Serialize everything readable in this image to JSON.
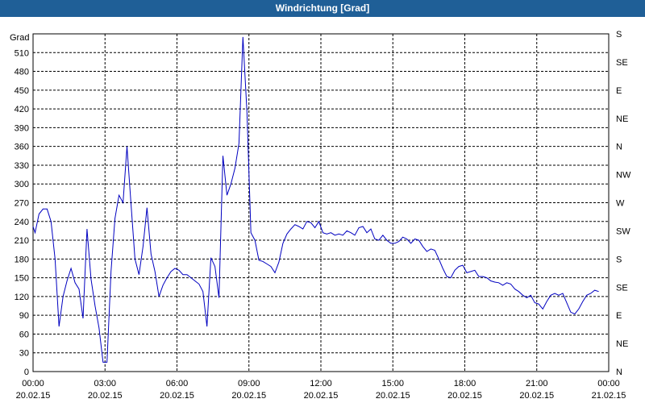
{
  "window": {
    "title": "Windrichtung [Grad]"
  },
  "chart_data": {
    "type": "line",
    "title": "Windrichtung [Grad]",
    "ylabel": "Grad",
    "xlabel": "",
    "grid": true,
    "legend": "none",
    "series_color": "#0000c0",
    "xlim_hours": [
      0,
      24
    ],
    "ylim": [
      0,
      540
    ],
    "y_ticks": [
      0,
      30,
      60,
      90,
      120,
      150,
      180,
      210,
      240,
      270,
      300,
      330,
      360,
      390,
      420,
      450,
      480,
      510
    ],
    "x_ticks": [
      {
        "time": "00:00",
        "date": "20.02.15"
      },
      {
        "time": "03:00",
        "date": "20.02.15"
      },
      {
        "time": "06:00",
        "date": "20.02.15"
      },
      {
        "time": "09:00",
        "date": "20.02.15"
      },
      {
        "time": "12:00",
        "date": "20.02.15"
      },
      {
        "time": "15:00",
        "date": "20.02.15"
      },
      {
        "time": "18:00",
        "date": "20.02.15"
      },
      {
        "time": "21:00",
        "date": "20.02.15"
      },
      {
        "time": "00:00",
        "date": "21.02.15"
      }
    ],
    "y2_ticks": [
      {
        "label": "N",
        "value": 0
      },
      {
        "label": "NE",
        "value": 45
      },
      {
        "label": "E",
        "value": 90
      },
      {
        "label": "SE",
        "value": 135
      },
      {
        "label": "S",
        "value": 180
      },
      {
        "label": "SW",
        "value": 225
      },
      {
        "label": "W",
        "value": 270
      },
      {
        "label": "NW",
        "value": 315
      },
      {
        "label": "N",
        "value": 360
      },
      {
        "label": "NE",
        "value": 405
      },
      {
        "label": "E",
        "value": 450
      },
      {
        "label": "SE",
        "value": 495
      },
      {
        "label": "S",
        "value": 540
      }
    ],
    "series": [
      {
        "values": [
          [
            "00:00",
            232
          ],
          [
            "00:05",
            222
          ],
          [
            "00:15",
            252
          ],
          [
            "00:25",
            260
          ],
          [
            "00:35",
            260
          ],
          [
            "00:45",
            240
          ],
          [
            "00:55",
            180
          ],
          [
            "01:05",
            72
          ],
          [
            "01:15",
            120
          ],
          [
            "01:25",
            145
          ],
          [
            "01:35",
            165
          ],
          [
            "01:45",
            142
          ],
          [
            "01:55",
            132
          ],
          [
            "02:05",
            85
          ],
          [
            "02:15",
            228
          ],
          [
            "02:25",
            148
          ],
          [
            "02:35",
            105
          ],
          [
            "02:45",
            70
          ],
          [
            "02:55",
            15
          ],
          [
            "03:05",
            15
          ],
          [
            "03:15",
            160
          ],
          [
            "03:25",
            245
          ],
          [
            "03:35",
            282
          ],
          [
            "03:45",
            270
          ],
          [
            "03:55",
            360
          ],
          [
            "04:05",
            268
          ],
          [
            "04:15",
            180
          ],
          [
            "04:25",
            155
          ],
          [
            "04:35",
            200
          ],
          [
            "04:45",
            262
          ],
          [
            "04:55",
            188
          ],
          [
            "05:05",
            160
          ],
          [
            "05:15",
            120
          ],
          [
            "05:25",
            138
          ],
          [
            "05:35",
            150
          ],
          [
            "05:45",
            160
          ],
          [
            "05:55",
            165
          ],
          [
            "06:05",
            162
          ],
          [
            "06:15",
            155
          ],
          [
            "06:25",
            155
          ],
          [
            "06:35",
            150
          ],
          [
            "06:45",
            145
          ],
          [
            "06:55",
            140
          ],
          [
            "07:05",
            128
          ],
          [
            "07:15",
            72
          ],
          [
            "07:25",
            182
          ],
          [
            "07:35",
            168
          ],
          [
            "07:45",
            118
          ],
          [
            "07:55",
            345
          ],
          [
            "08:05",
            282
          ],
          [
            "08:15",
            300
          ],
          [
            "08:25",
            325
          ],
          [
            "08:35",
            365
          ],
          [
            "08:45",
            535
          ],
          [
            "08:55",
            415
          ],
          [
            "09:05",
            222
          ],
          [
            "09:15",
            210
          ],
          [
            "09:25",
            178
          ],
          [
            "09:35",
            176
          ],
          [
            "09:45",
            172
          ],
          [
            "09:55",
            168
          ],
          [
            "10:05",
            158
          ],
          [
            "10:15",
            175
          ],
          [
            "10:25",
            205
          ],
          [
            "10:35",
            220
          ],
          [
            "10:45",
            228
          ],
          [
            "10:55",
            235
          ],
          [
            "11:05",
            232
          ],
          [
            "11:15",
            228
          ],
          [
            "11:25",
            240
          ],
          [
            "11:35",
            238
          ],
          [
            "11:45",
            230
          ],
          [
            "11:55",
            240
          ],
          [
            "12:05",
            222
          ],
          [
            "12:15",
            220
          ],
          [
            "12:25",
            222
          ],
          [
            "12:35",
            218
          ],
          [
            "12:45",
            220
          ],
          [
            "12:55",
            218
          ],
          [
            "13:05",
            225
          ],
          [
            "13:15",
            222
          ],
          [
            "13:25",
            218
          ],
          [
            "13:35",
            230
          ],
          [
            "13:45",
            232
          ],
          [
            "13:55",
            222
          ],
          [
            "14:05",
            228
          ],
          [
            "14:15",
            212
          ],
          [
            "14:25",
            210
          ],
          [
            "14:35",
            218
          ],
          [
            "14:45",
            210
          ],
          [
            "14:55",
            205
          ],
          [
            "15:05",
            205
          ],
          [
            "15:15",
            208
          ],
          [
            "15:25",
            215
          ],
          [
            "15:35",
            212
          ],
          [
            "15:45",
            205
          ],
          [
            "15:55",
            212
          ],
          [
            "16:05",
            210
          ],
          [
            "16:15",
            200
          ],
          [
            "16:25",
            192
          ],
          [
            "16:35",
            196
          ],
          [
            "16:45",
            194
          ],
          [
            "16:55",
            180
          ],
          [
            "17:05",
            165
          ],
          [
            "17:15",
            152
          ],
          [
            "17:25",
            150
          ],
          [
            "17:35",
            162
          ],
          [
            "17:45",
            168
          ],
          [
            "17:55",
            170
          ],
          [
            "18:05",
            158
          ],
          [
            "18:15",
            160
          ],
          [
            "18:25",
            162
          ],
          [
            "18:35",
            152
          ],
          [
            "18:45",
            152
          ],
          [
            "18:55",
            150
          ],
          [
            "19:05",
            145
          ],
          [
            "19:15",
            143
          ],
          [
            "19:25",
            142
          ],
          [
            "19:35",
            138
          ],
          [
            "19:45",
            142
          ],
          [
            "19:55",
            140
          ],
          [
            "20:05",
            132
          ],
          [
            "20:15",
            128
          ],
          [
            "20:25",
            122
          ],
          [
            "20:35",
            118
          ],
          [
            "20:45",
            122
          ],
          [
            "20:55",
            110
          ],
          [
            "21:05",
            108
          ],
          [
            "21:15",
            100
          ],
          [
            "21:25",
            112
          ],
          [
            "21:35",
            122
          ],
          [
            "21:45",
            125
          ],
          [
            "21:55",
            122
          ],
          [
            "22:05",
            125
          ],
          [
            "22:15",
            110
          ],
          [
            "22:25",
            95
          ],
          [
            "22:35",
            92
          ],
          [
            "22:45",
            100
          ],
          [
            "22:55",
            112
          ],
          [
            "23:05",
            122
          ],
          [
            "23:15",
            125
          ],
          [
            "23:25",
            130
          ],
          [
            "23:35",
            128
          ]
        ]
      }
    ]
  }
}
